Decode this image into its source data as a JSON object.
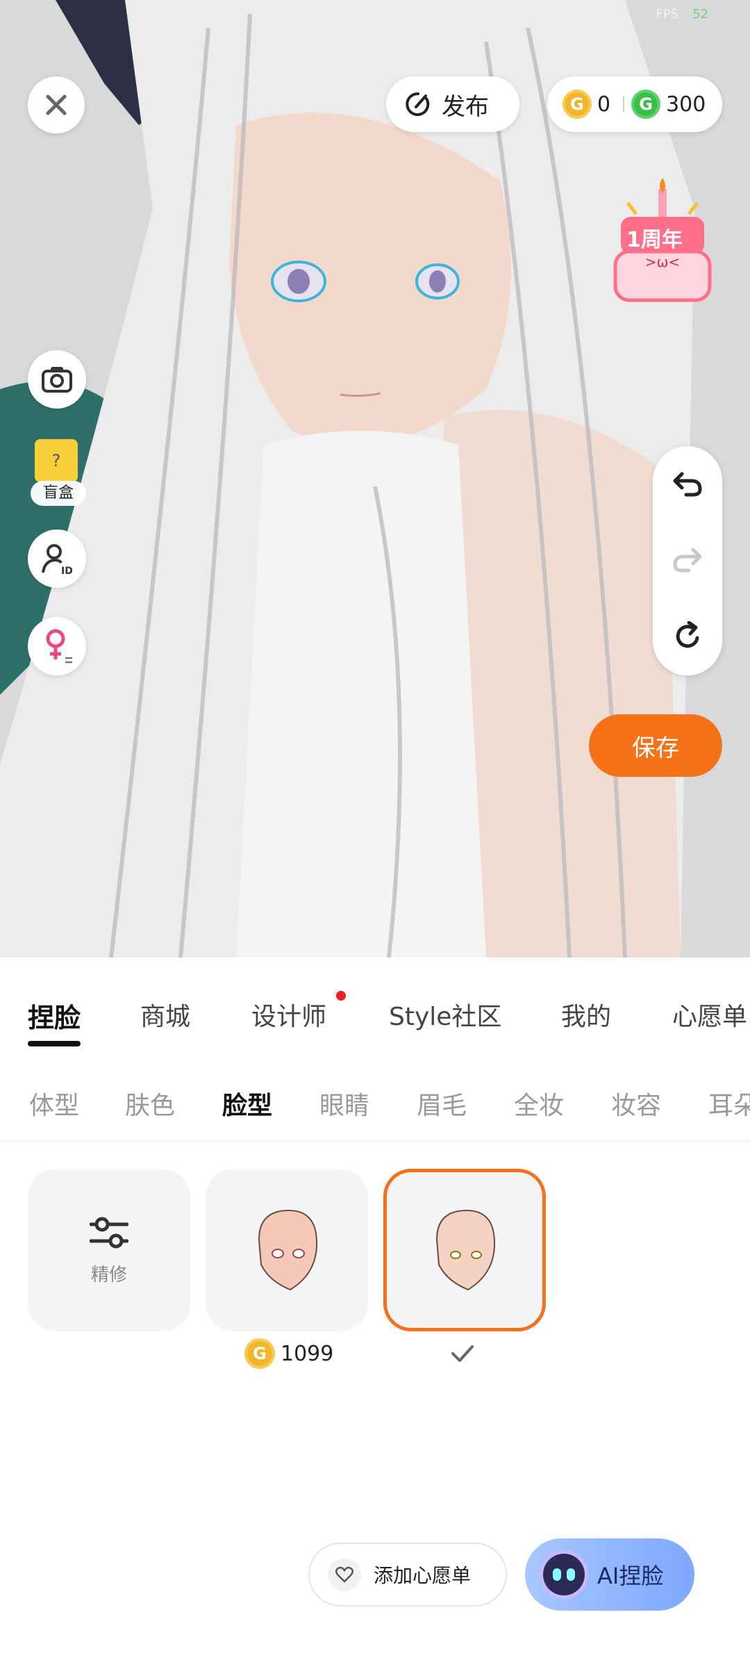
{
  "status": {
    "fps_label": "FPS",
    "fps_value": "52"
  },
  "top_bar": {
    "publish_label": "发布",
    "gold_coin_value": "0",
    "green_coin_value": "300"
  },
  "left_tools": {
    "blind_box_label": "盲盒"
  },
  "anniversary_badge": "1周年",
  "save_label": "保存",
  "main_tabs": [
    {
      "label": "捏脸"
    },
    {
      "label": "商城"
    },
    {
      "label": "设计师"
    },
    {
      "label": "Style社区"
    },
    {
      "label": "我的"
    },
    {
      "label": "心愿单"
    }
  ],
  "sub_tabs": [
    {
      "label": "体型"
    },
    {
      "label": "肤色"
    },
    {
      "label": "脸型"
    },
    {
      "label": "眼睛"
    },
    {
      "label": "眉毛"
    },
    {
      "label": "全妆"
    },
    {
      "label": "妆容"
    },
    {
      "label": "耳朵"
    }
  ],
  "items": {
    "refine_label": "精修",
    "item2_price": "1099"
  },
  "bottom": {
    "wishlist_label": "添加心愿单",
    "ai_label": "AI捏脸"
  },
  "colors": {
    "accent": "#f57218",
    "notify": "#e82020"
  }
}
